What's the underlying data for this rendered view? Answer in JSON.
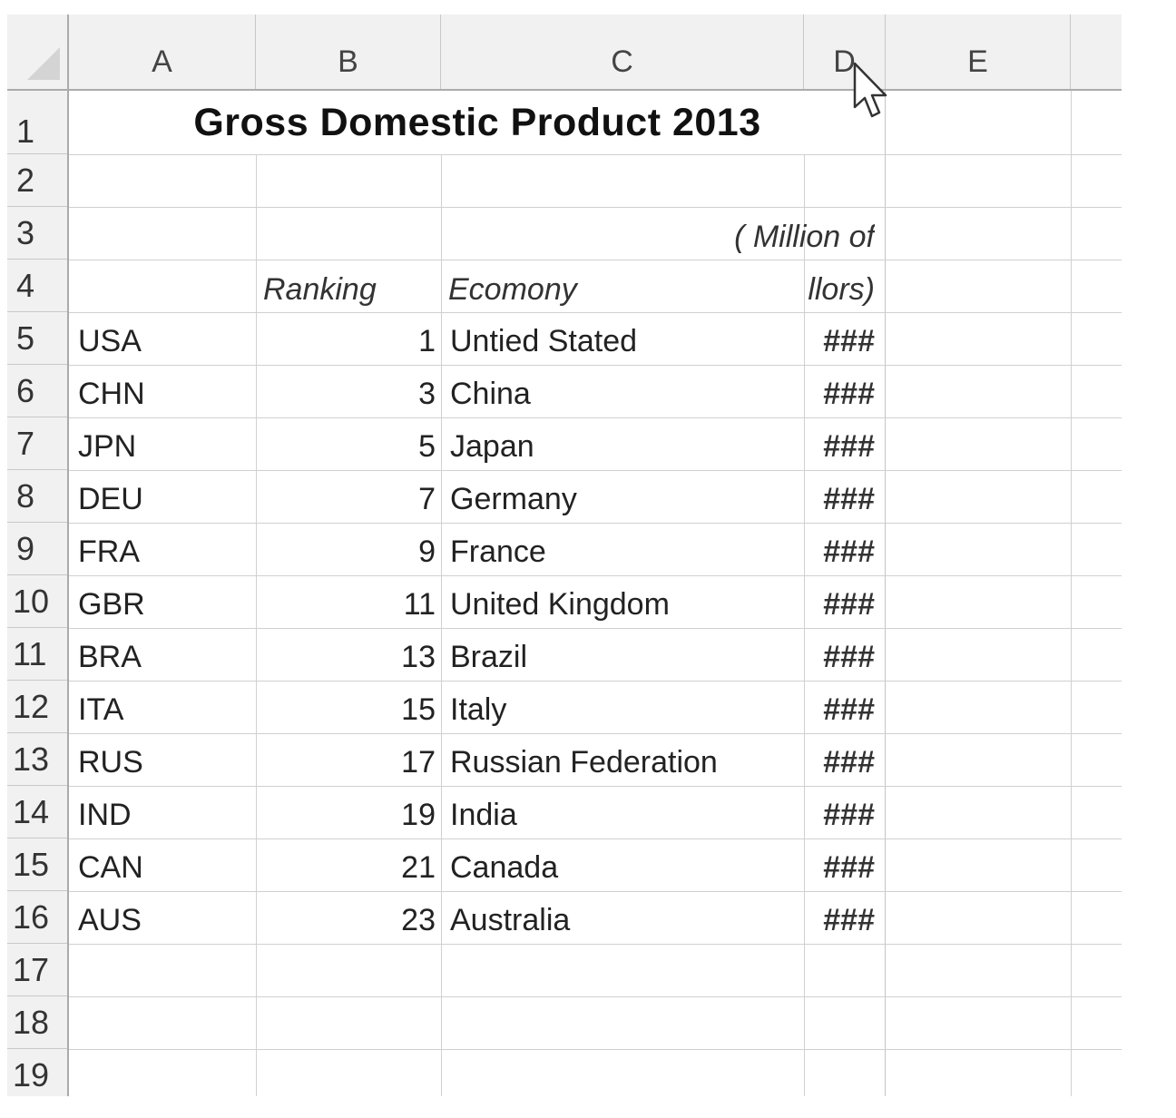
{
  "columns": [
    "A",
    "B",
    "C",
    "D",
    "E"
  ],
  "rows": [
    "1",
    "2",
    "3",
    "4",
    "5",
    "6",
    "7",
    "8",
    "9",
    "10",
    "11",
    "12",
    "13",
    "14",
    "15",
    "16",
    "17",
    "18",
    "19"
  ],
  "title": "Gross Domestic Product 2013",
  "units_line1": "( Million of",
  "units_line2": "llors)",
  "headers": {
    "ranking": "Ranking",
    "economy": "Ecomony"
  },
  "data": [
    {
      "code": "USA",
      "rank": "1",
      "name": "Untied Stated",
      "value": "###"
    },
    {
      "code": "CHN",
      "rank": "3",
      "name": "China",
      "value": "###"
    },
    {
      "code": "JPN",
      "rank": "5",
      "name": "Japan",
      "value": "###"
    },
    {
      "code": "DEU",
      "rank": "7",
      "name": "Germany",
      "value": "###"
    },
    {
      "code": "FRA",
      "rank": "9",
      "name": "France",
      "value": "###"
    },
    {
      "code": "GBR",
      "rank": "11",
      "name": "United Kingdom",
      "value": "###"
    },
    {
      "code": "BRA",
      "rank": "13",
      "name": "Brazil",
      "value": "###"
    },
    {
      "code": "ITA",
      "rank": "15",
      "name": "Italy",
      "value": "###"
    },
    {
      "code": "RUS",
      "rank": "17",
      "name": "Russian Federation",
      "value": "###"
    },
    {
      "code": "IND",
      "rank": "19",
      "name": "India",
      "value": "###"
    },
    {
      "code": "CAN",
      "rank": "21",
      "name": "Canada",
      "value": "###"
    },
    {
      "code": "AUS",
      "rank": "23",
      "name": "Australia",
      "value": "###"
    }
  ],
  "icons": {
    "corner": "select-all-triangle-icon",
    "cursor": "mouse-pointer-icon"
  }
}
